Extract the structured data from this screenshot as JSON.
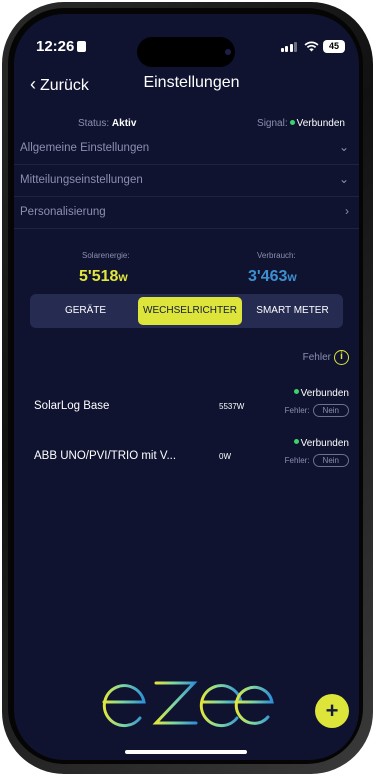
{
  "status_bar": {
    "time": "12:26",
    "battery": "45"
  },
  "nav": {
    "back_label": "Zurück",
    "title": "Einstellungen"
  },
  "status_row": {
    "status_label": "Status:",
    "status_value": "Aktiv",
    "signal_label": "Signal:",
    "signal_value": "Verbunden"
  },
  "menu": [
    {
      "label": "Allgemeine Einstellungen",
      "icon": "chevron-down-icon"
    },
    {
      "label": "Mitteilungseinstellungen",
      "icon": "chevron-down-icon"
    },
    {
      "label": "Personalisierung",
      "icon": "chevron-right-icon"
    }
  ],
  "energy": {
    "solar_label": "Solarenergie:",
    "solar_value": "5'518",
    "solar_unit": "w",
    "consumption_label": "Verbrauch:",
    "consumption_value": "3'463",
    "consumption_unit": "w"
  },
  "tabs": [
    {
      "label": "GERÄTE",
      "active": false
    },
    {
      "label": "WECHSELRICHTER",
      "active": true
    },
    {
      "label": "SMART METER",
      "active": false
    }
  ],
  "devices_header": {
    "fehler_label": "Fehler"
  },
  "devices": [
    {
      "name": "SolarLog Base",
      "power": "5537W",
      "status": "Verbunden",
      "fehler_label": "Fehler:",
      "fehler_value": "Nein"
    },
    {
      "name": "ABB UNO/PVI/TRIO mit V...",
      "power": "0W",
      "status": "Verbunden",
      "fehler_label": "Fehler:",
      "fehler_value": "Nein"
    }
  ],
  "logo": {
    "text": "ezee"
  },
  "fab": {
    "label": "+"
  },
  "colors": {
    "accent": "#dde53a",
    "background": "#0f1330",
    "connected": "#3bd46a",
    "solar": "#e2e63c",
    "consumption": "#3e8fd0"
  }
}
